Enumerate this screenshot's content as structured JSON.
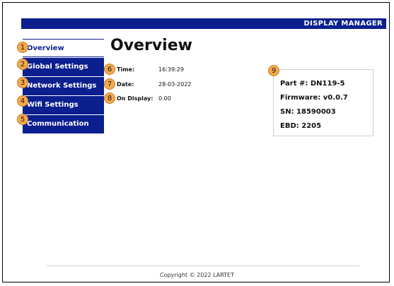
{
  "header": {
    "title": "DISPLAY MANAGER"
  },
  "sidebar": {
    "items": [
      {
        "badge": "1",
        "label": "Overview"
      },
      {
        "badge": "2",
        "label": "Global Settings"
      },
      {
        "badge": "3",
        "label": "Network Settings"
      },
      {
        "badge": "4",
        "label": "Wifi Settings"
      },
      {
        "badge": "5",
        "label": "Communication"
      }
    ]
  },
  "main": {
    "title": "Overview",
    "fields": [
      {
        "badge": "6",
        "label": "Time:",
        "value": "16:39:29"
      },
      {
        "badge": "7",
        "label": "Date:",
        "value": "28-03-2022"
      },
      {
        "badge": "8",
        "label": "On Display:",
        "value": "0.00"
      }
    ]
  },
  "device_card": {
    "badge": "9",
    "part": "Part #:  DN119-5",
    "firmware": "Firmware:  v0.0.7",
    "sn": "SN: 18590003",
    "ebd": "EBD: 2205"
  },
  "footer": {
    "copyright": "Copyright © 2022 LARTET"
  },
  "colors": {
    "nav_blue": "#0b1f8f",
    "badge_orange": "#f4a84b"
  }
}
